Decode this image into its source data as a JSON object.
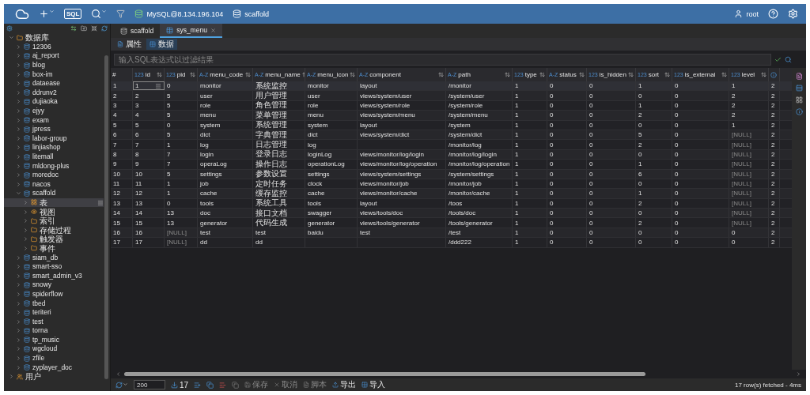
{
  "toolbar": {
    "sql_label": "SQL",
    "connection": "MySQL@8.134.196.104",
    "database": "scaffold",
    "user": "root"
  },
  "sidebar": {
    "tree": [
      {
        "label": "数据库",
        "kind": "group",
        "expanded": true,
        "selected": false,
        "children": [
          {
            "label": "12306",
            "kind": "database",
            "expanded": false,
            "selected": false
          },
          {
            "label": "aj_report",
            "kind": "database",
            "expanded": false,
            "selected": false
          },
          {
            "label": "blog",
            "kind": "database",
            "expanded": false,
            "selected": false
          },
          {
            "label": "box-im",
            "kind": "database",
            "expanded": false,
            "selected": false
          },
          {
            "label": "dataease",
            "kind": "database",
            "expanded": false,
            "selected": false
          },
          {
            "label": "ddrunv2",
            "kind": "database",
            "expanded": false,
            "selected": false
          },
          {
            "label": "dujiaoka",
            "kind": "database",
            "expanded": false,
            "selected": false
          },
          {
            "label": "ejyy",
            "kind": "database",
            "expanded": false,
            "selected": false
          },
          {
            "label": "exam",
            "kind": "database",
            "expanded": false,
            "selected": false
          },
          {
            "label": "jpress",
            "kind": "database",
            "expanded": false,
            "selected": false
          },
          {
            "label": "labor-group",
            "kind": "database",
            "expanded": false,
            "selected": false
          },
          {
            "label": "linjiashop",
            "kind": "database",
            "expanded": false,
            "selected": false
          },
          {
            "label": "litemall",
            "kind": "database",
            "expanded": false,
            "selected": false
          },
          {
            "label": "mldong-plus",
            "kind": "database",
            "expanded": false,
            "selected": false
          },
          {
            "label": "moredoc",
            "kind": "database",
            "expanded": false,
            "selected": false
          },
          {
            "label": "nacos",
            "kind": "database",
            "expanded": false,
            "selected": false
          },
          {
            "label": "scaffold",
            "kind": "database",
            "expanded": true,
            "selected": false,
            "children": [
              {
                "label": "表",
                "kind": "tables",
                "expanded": false,
                "selected": true
              },
              {
                "label": "视图",
                "kind": "views",
                "expanded": false,
                "selected": false
              },
              {
                "label": "索引",
                "kind": "folder",
                "expanded": false,
                "selected": false
              },
              {
                "label": "存储过程",
                "kind": "folder",
                "expanded": false,
                "selected": false
              },
              {
                "label": "触发器",
                "kind": "folder",
                "expanded": false,
                "selected": false
              },
              {
                "label": "事件",
                "kind": "folder",
                "expanded": false,
                "selected": false
              }
            ]
          },
          {
            "label": "siam_db",
            "kind": "database",
            "expanded": false,
            "selected": false
          },
          {
            "label": "smart-sso",
            "kind": "database",
            "expanded": false,
            "selected": false
          },
          {
            "label": "smart_admin_v3",
            "kind": "database",
            "expanded": false,
            "selected": false
          },
          {
            "label": "snowy",
            "kind": "database",
            "expanded": false,
            "selected": false
          },
          {
            "label": "spiderflow",
            "kind": "database",
            "expanded": false,
            "selected": false
          },
          {
            "label": "tbed",
            "kind": "database",
            "expanded": false,
            "selected": false
          },
          {
            "label": "teriteri",
            "kind": "database",
            "expanded": false,
            "selected": false
          },
          {
            "label": "test",
            "kind": "database",
            "expanded": false,
            "selected": false
          },
          {
            "label": "torna",
            "kind": "database",
            "expanded": false,
            "selected": false
          },
          {
            "label": "tp_music",
            "kind": "database",
            "expanded": false,
            "selected": false
          },
          {
            "label": "wgcloud",
            "kind": "database",
            "expanded": false,
            "selected": false
          },
          {
            "label": "zfile",
            "kind": "database",
            "expanded": false,
            "selected": false
          },
          {
            "label": "zyplayer_doc",
            "kind": "database",
            "expanded": false,
            "selected": false
          }
        ]
      },
      {
        "label": "用户",
        "kind": "users",
        "expanded": false,
        "selected": false
      }
    ]
  },
  "editor_tabs": [
    {
      "label": "scaffold",
      "kind": "database",
      "selected": false
    },
    {
      "label": "sys_menu",
      "kind": "table",
      "selected": true
    }
  ],
  "view_tabs": [
    {
      "label": "属性",
      "selected": false
    },
    {
      "label": "数据",
      "selected": true
    }
  ],
  "filter": {
    "placeholder": "输入SQL表达式以过滤结果"
  },
  "table": {
    "columns": [
      {
        "name": "#"
      },
      {
        "name": "id",
        "type": "123"
      },
      {
        "name": "pid",
        "type": "123"
      },
      {
        "name": "menu_code",
        "type": "A-Z"
      },
      {
        "name": "menu_name",
        "type": "A-Z"
      },
      {
        "name": "menu_icon",
        "type": "A-Z"
      },
      {
        "name": "component",
        "type": "A-Z"
      },
      {
        "name": "path",
        "type": "A-Z"
      },
      {
        "name": "type",
        "type": "123"
      },
      {
        "name": "status",
        "type": "A-Z"
      },
      {
        "name": "is_hidden",
        "type": "123"
      },
      {
        "name": "sort",
        "type": "123"
      },
      {
        "name": "is_external",
        "type": "123"
      },
      {
        "name": "level",
        "type": "123"
      },
      {}
    ],
    "rows": [
      {
        "selected": true,
        "cells": [
          "1",
          "1",
          "0",
          "monitor",
          "系统监控",
          "monitor",
          "layout",
          "/monitor",
          "1",
          "0",
          "0",
          "1",
          "0",
          "1",
          "2"
        ]
      },
      {
        "selected": false,
        "cells": [
          "2",
          "2",
          "5",
          "user",
          "用户管理",
          "user",
          "views/system/user",
          "/system/user",
          "1",
          "0",
          "0",
          "0",
          "0",
          "2",
          "2"
        ]
      },
      {
        "selected": false,
        "cells": [
          "3",
          "3",
          "5",
          "role",
          "角色管理",
          "role",
          "views/system/role",
          "/system/role",
          "1",
          "0",
          "0",
          "1",
          "0",
          "2",
          "2"
        ]
      },
      {
        "selected": false,
        "cells": [
          "4",
          "4",
          "5",
          "menu",
          "菜单管理",
          "menu",
          "views/system/menu",
          "/system/menu",
          "1",
          "0",
          "0",
          "2",
          "0",
          "2",
          "2"
        ]
      },
      {
        "selected": false,
        "cells": [
          "5",
          "5",
          "0",
          "system",
          "系统管理",
          "system",
          "layout",
          "/system",
          "1",
          "0",
          "0",
          "0",
          "0",
          "1",
          "2"
        ]
      },
      {
        "selected": false,
        "cells": [
          "6",
          "6",
          "5",
          "dict",
          "字典管理",
          "dict",
          "views/system/dict",
          "/system/dict",
          "1",
          "0",
          "0",
          "5",
          "0",
          {
            "text": "[NULL]",
            "kind": "null"
          },
          "2"
        ]
      },
      {
        "selected": false,
        "cells": [
          "7",
          "7",
          "1",
          "log",
          "日志管理",
          "log",
          null,
          "/monitor/log",
          "1",
          "0",
          "0",
          "2",
          "0",
          {
            "text": "[NULL]",
            "kind": "null"
          },
          "2"
        ]
      },
      {
        "selected": false,
        "cells": [
          "8",
          "8",
          "7",
          "login",
          "登录日志",
          "loginLog",
          "views/monitor/log/login",
          "/monitor/log/login",
          "1",
          "0",
          "0",
          "0",
          "0",
          {
            "text": "[NULL]",
            "kind": "null"
          },
          "2"
        ]
      },
      {
        "selected": false,
        "cells": [
          "9",
          "9",
          "7",
          "operaLog",
          "操作日志",
          "operationLog",
          "views/monitor/log/operation",
          "/monitor/log/operation",
          "1",
          "0",
          "0",
          "1",
          "0",
          {
            "text": "[NULL]",
            "kind": "null"
          },
          "2"
        ]
      },
      {
        "selected": false,
        "cells": [
          "10",
          "10",
          "5",
          "settings",
          "参数设置",
          "settings",
          "views/system/settings",
          "/system/settings",
          "1",
          "0",
          "0",
          "6",
          "0",
          {
            "text": "[NULL]",
            "kind": "null"
          },
          "2"
        ]
      },
      {
        "selected": false,
        "cells": [
          "11",
          "11",
          "1",
          "job",
          "定时任务",
          "clock",
          "views/monitor/job",
          "/monitor/job",
          "1",
          "0",
          "0",
          "0",
          "0",
          {
            "text": "[NULL]",
            "kind": "null"
          },
          "2"
        ]
      },
      {
        "selected": false,
        "cells": [
          "12",
          "12",
          "1",
          "cache",
          "缓存监控",
          "cache",
          "views/monitor/cache",
          "/monitor/cache",
          "1",
          "0",
          "0",
          "1",
          "0",
          {
            "text": "[NULL]",
            "kind": "null"
          },
          "2"
        ]
      },
      {
        "selected": false,
        "cells": [
          "13",
          "13",
          "0",
          "tools",
          "系统工具",
          "tools",
          "layout",
          "/toos",
          "1",
          "0",
          "0",
          "2",
          "0",
          {
            "text": "[NULL]",
            "kind": "null"
          },
          "2"
        ]
      },
      {
        "selected": false,
        "cells": [
          "14",
          "14",
          "13",
          "doc",
          "接口文档",
          "swagger",
          "views/tools/doc",
          "/tools/doc",
          "1",
          "0",
          "0",
          "0",
          "0",
          {
            "text": "[NULL]",
            "kind": "null"
          },
          "2"
        ]
      },
      {
        "selected": false,
        "cells": [
          "15",
          "15",
          "13",
          "generator",
          "代码生成",
          "generator",
          "views/tools/generator",
          "/tools/generator",
          "1",
          "0",
          "0",
          "2",
          "0",
          {
            "text": "[NULL]",
            "kind": "null"
          },
          "2"
        ]
      },
      {
        "selected": false,
        "cells": [
          "16",
          "16",
          {
            "text": "[NULL]",
            "kind": "null"
          },
          "test",
          "test",
          "baidu",
          "test",
          "/test",
          "1",
          "0",
          "0",
          "0",
          "0",
          "0",
          "2"
        ]
      },
      {
        "selected": false,
        "cells": [
          "17",
          "17",
          {
            "text": "[NULL]",
            "kind": "null"
          },
          "dd",
          "dd",
          null,
          null,
          "/ddd222",
          "1",
          "0",
          "0",
          "0",
          "0",
          "0",
          "2"
        ]
      }
    ]
  },
  "status_bar": {
    "limit": "200",
    "row_count": "17",
    "actions": [
      {
        "label": "保存",
        "disabled": true
      },
      {
        "label": "取消",
        "disabled": true
      },
      {
        "label": "脚本",
        "disabled": true
      },
      {
        "label": "导出",
        "disabled": false
      },
      {
        "label": "导入",
        "disabled": false
      }
    ],
    "summary": "17 row(s) fetched - 4ms"
  }
}
